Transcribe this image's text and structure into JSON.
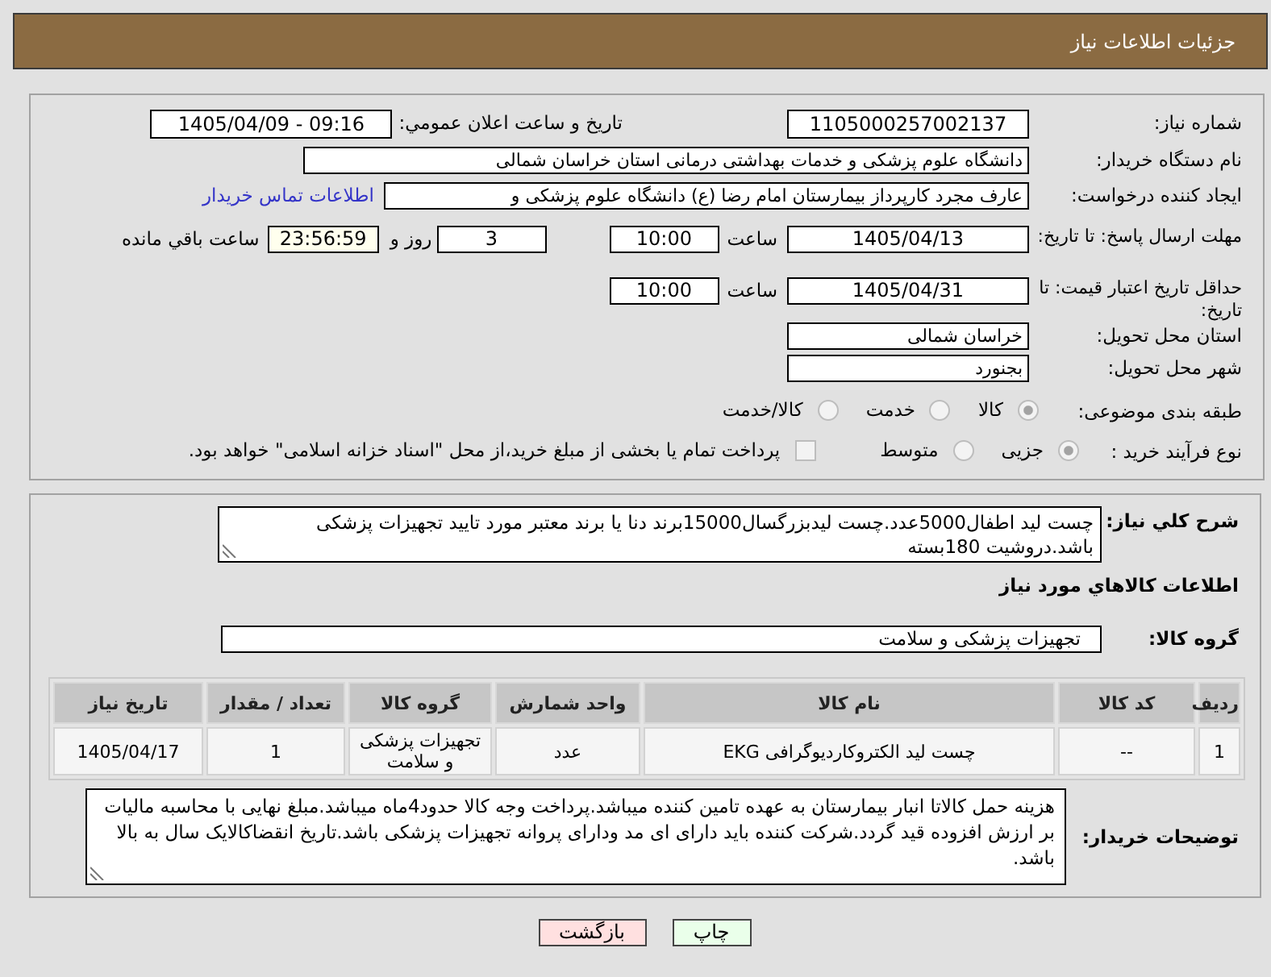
{
  "header": {
    "title": "جزئیات اطلاعات نیاز"
  },
  "details": {
    "need_number": {
      "label": "شماره نیاز:",
      "value": "1105000257002137"
    },
    "announce": {
      "label": "تاریخ و ساعت اعلان عمومي:",
      "value": "1405/04/09 - 09:16"
    },
    "buyer_org": {
      "label": "نام دستگاه خریدار:",
      "value": "دانشگاه علوم پزشکی و خدمات بهداشتی درمانی استان خراسان شمالی"
    },
    "requester": {
      "label": "ایجاد کننده درخواست:",
      "value": "عارف مجرد کارپرداز بیمارستان امام رضا (ع) دانشگاه علوم پزشکی و",
      "link": "اطلاعات تماس خریدار"
    },
    "reply_deadline": {
      "label": "مهلت ارسال پاسخ: تا تاریخ:",
      "date": "1405/04/13",
      "time_label": "ساعت",
      "time": "10:00",
      "days": "3",
      "days_label": "روز و",
      "remaining": "23:56:59",
      "remaining_label": "ساعت باقي مانده"
    },
    "price_validity": {
      "label": "حداقل تاریخ اعتبار قیمت: تا تاریخ:",
      "date": "1405/04/31",
      "time_label": "ساعت",
      "time": "10:00"
    },
    "province": {
      "label": "استان محل تحویل:",
      "value": "خراسان شمالی"
    },
    "city": {
      "label": "شهر محل تحویل:",
      "value": "بجنورد"
    },
    "category": {
      "label": "طبقه بندی موضوعی:",
      "options": [
        {
          "label": "کالا",
          "selected": true
        },
        {
          "label": "خدمت",
          "selected": false
        },
        {
          "label": "کالا/خدمت",
          "selected": false
        }
      ]
    },
    "process": {
      "label": "نوع فرآیند خرید :",
      "options": [
        {
          "label": "جزیی",
          "selected": true
        },
        {
          "label": "متوسط",
          "selected": false
        }
      ],
      "treasury": {
        "label": "پرداخت تمام یا بخشی از مبلغ خرید،از محل \"اسناد خزانه اسلامی\" خواهد بود.",
        "checked": false
      }
    }
  },
  "description": {
    "label": "شرح کلي نياز:",
    "value": "چست لید اطفال5000عدد.چست لیدبزرگسال15000برند دنا یا برند معتبر مورد تایید تجهیزات پزشکی باشد.دروشیت 180بسته"
  },
  "items_heading": "اطلاعات کالاهاي مورد نياز",
  "goods_group": {
    "label": "گروه کالا:",
    "value": "تجهیزات پزشکی و سلامت"
  },
  "table": {
    "columns": [
      "ردیف",
      "کد کالا",
      "نام کالا",
      "واحد شمارش",
      "گروه کالا",
      "تعداد / مقدار",
      "تاریخ نیاز"
    ],
    "rows": [
      [
        "1",
        "--",
        "چست لید الکتروکاردیوگرافی EKG",
        "عدد",
        "تجهیزات پزشکی و سلامت",
        "1",
        "1405/04/17"
      ]
    ]
  },
  "buyer_notes": {
    "label": "توضیحات خریدار:",
    "value": "هزینه حمل کالاتا انبار بیمارستان به عهده تامین کننده میباشد.پرداخت وجه کالا حدود4ماه میباشد.مبلغ نهایی با محاسبه مالیات بر ارزش افزوده قید گردد.شرکت کننده باید دارای ای مد ودارای پروانه تجهیزات پزشکی باشد.تاریخ انقضاکالایک سال به بالا باشد."
  },
  "buttons": [
    {
      "label": "چاپ",
      "kind": "print"
    },
    {
      "label": "بازگشت",
      "kind": "back"
    }
  ]
}
